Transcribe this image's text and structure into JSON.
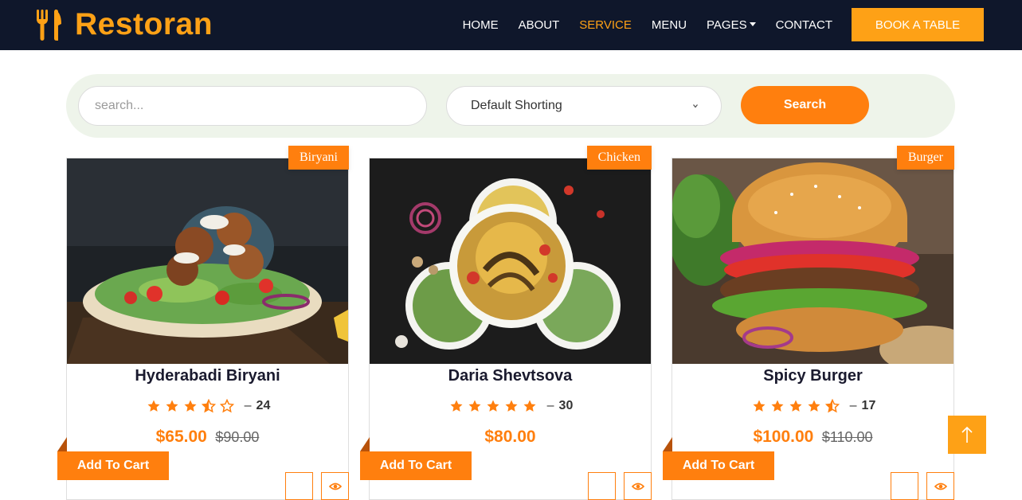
{
  "navbar": {
    "brand": "Restoran",
    "links": [
      {
        "label": "HOME",
        "active": false
      },
      {
        "label": "ABOUT",
        "active": false
      },
      {
        "label": "SERVICE",
        "active": true
      },
      {
        "label": "MENU",
        "active": false
      },
      {
        "label": "PAGES",
        "active": false,
        "dropdown": true
      },
      {
        "label": "CONTACT",
        "active": false
      }
    ],
    "cta_label": "BOOK A TABLE"
  },
  "filter": {
    "search_placeholder": "search...",
    "search_value": "",
    "sort_selected": "Default Shorting",
    "search_button": "Search"
  },
  "products": [
    {
      "tag": "Biryani",
      "title": "Hyderabadi Biryani",
      "rating": 3.5,
      "review_count": "24",
      "price": "$65.00",
      "old_price": "$90.00",
      "cart_label": "Add To Cart"
    },
    {
      "tag": "Chicken",
      "title": "Daria Shevtsova",
      "rating": 5,
      "review_count": "30",
      "price": "$80.00",
      "old_price": "",
      "cart_label": "Add To Cart"
    },
    {
      "tag": "Burger",
      "title": "Spicy Burger",
      "rating": 4.5,
      "review_count": "17",
      "price": "$100.00",
      "old_price": "$110.00",
      "cart_label": "Add To Cart"
    }
  ],
  "colors": {
    "navy": "#0f172b",
    "primary": "#fea116",
    "accent": "#ff7f0e",
    "search_bg": "#eef4ea"
  },
  "icons": {
    "brand": "utensils-icon",
    "sort": "chevron-down-icon",
    "rating": "star-icon",
    "view": "eye-icon",
    "back_to_top": "arrow-up-icon"
  }
}
